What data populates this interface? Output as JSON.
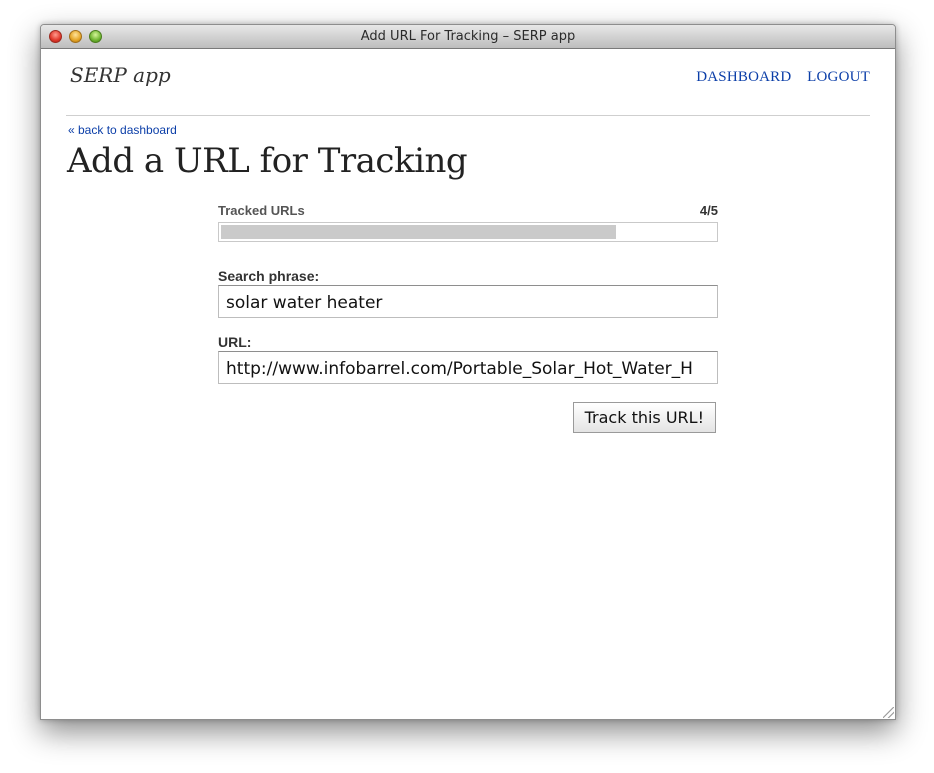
{
  "window": {
    "title": "Add URL For Tracking – SERP app"
  },
  "header": {
    "brand": "SERP app",
    "nav": [
      {
        "label": "DASHBOARD"
      },
      {
        "label": "LOGOUT"
      }
    ]
  },
  "back_link": "« back to dashboard",
  "page_title": "Add a URL for Tracking",
  "tracked": {
    "label": "Tracked URLs",
    "count_text": "4/5",
    "used": 4,
    "limit": 5
  },
  "form": {
    "search_label": "Search phrase:",
    "search_value": "solar water heater",
    "url_label": "URL:",
    "url_value": "http://www.infobarrel.com/Portable_Solar_Hot_Water_H",
    "submit_label": "Track this URL!"
  },
  "colors": {
    "link": "#0b3ea8",
    "progress_fill": "#cacaca"
  }
}
